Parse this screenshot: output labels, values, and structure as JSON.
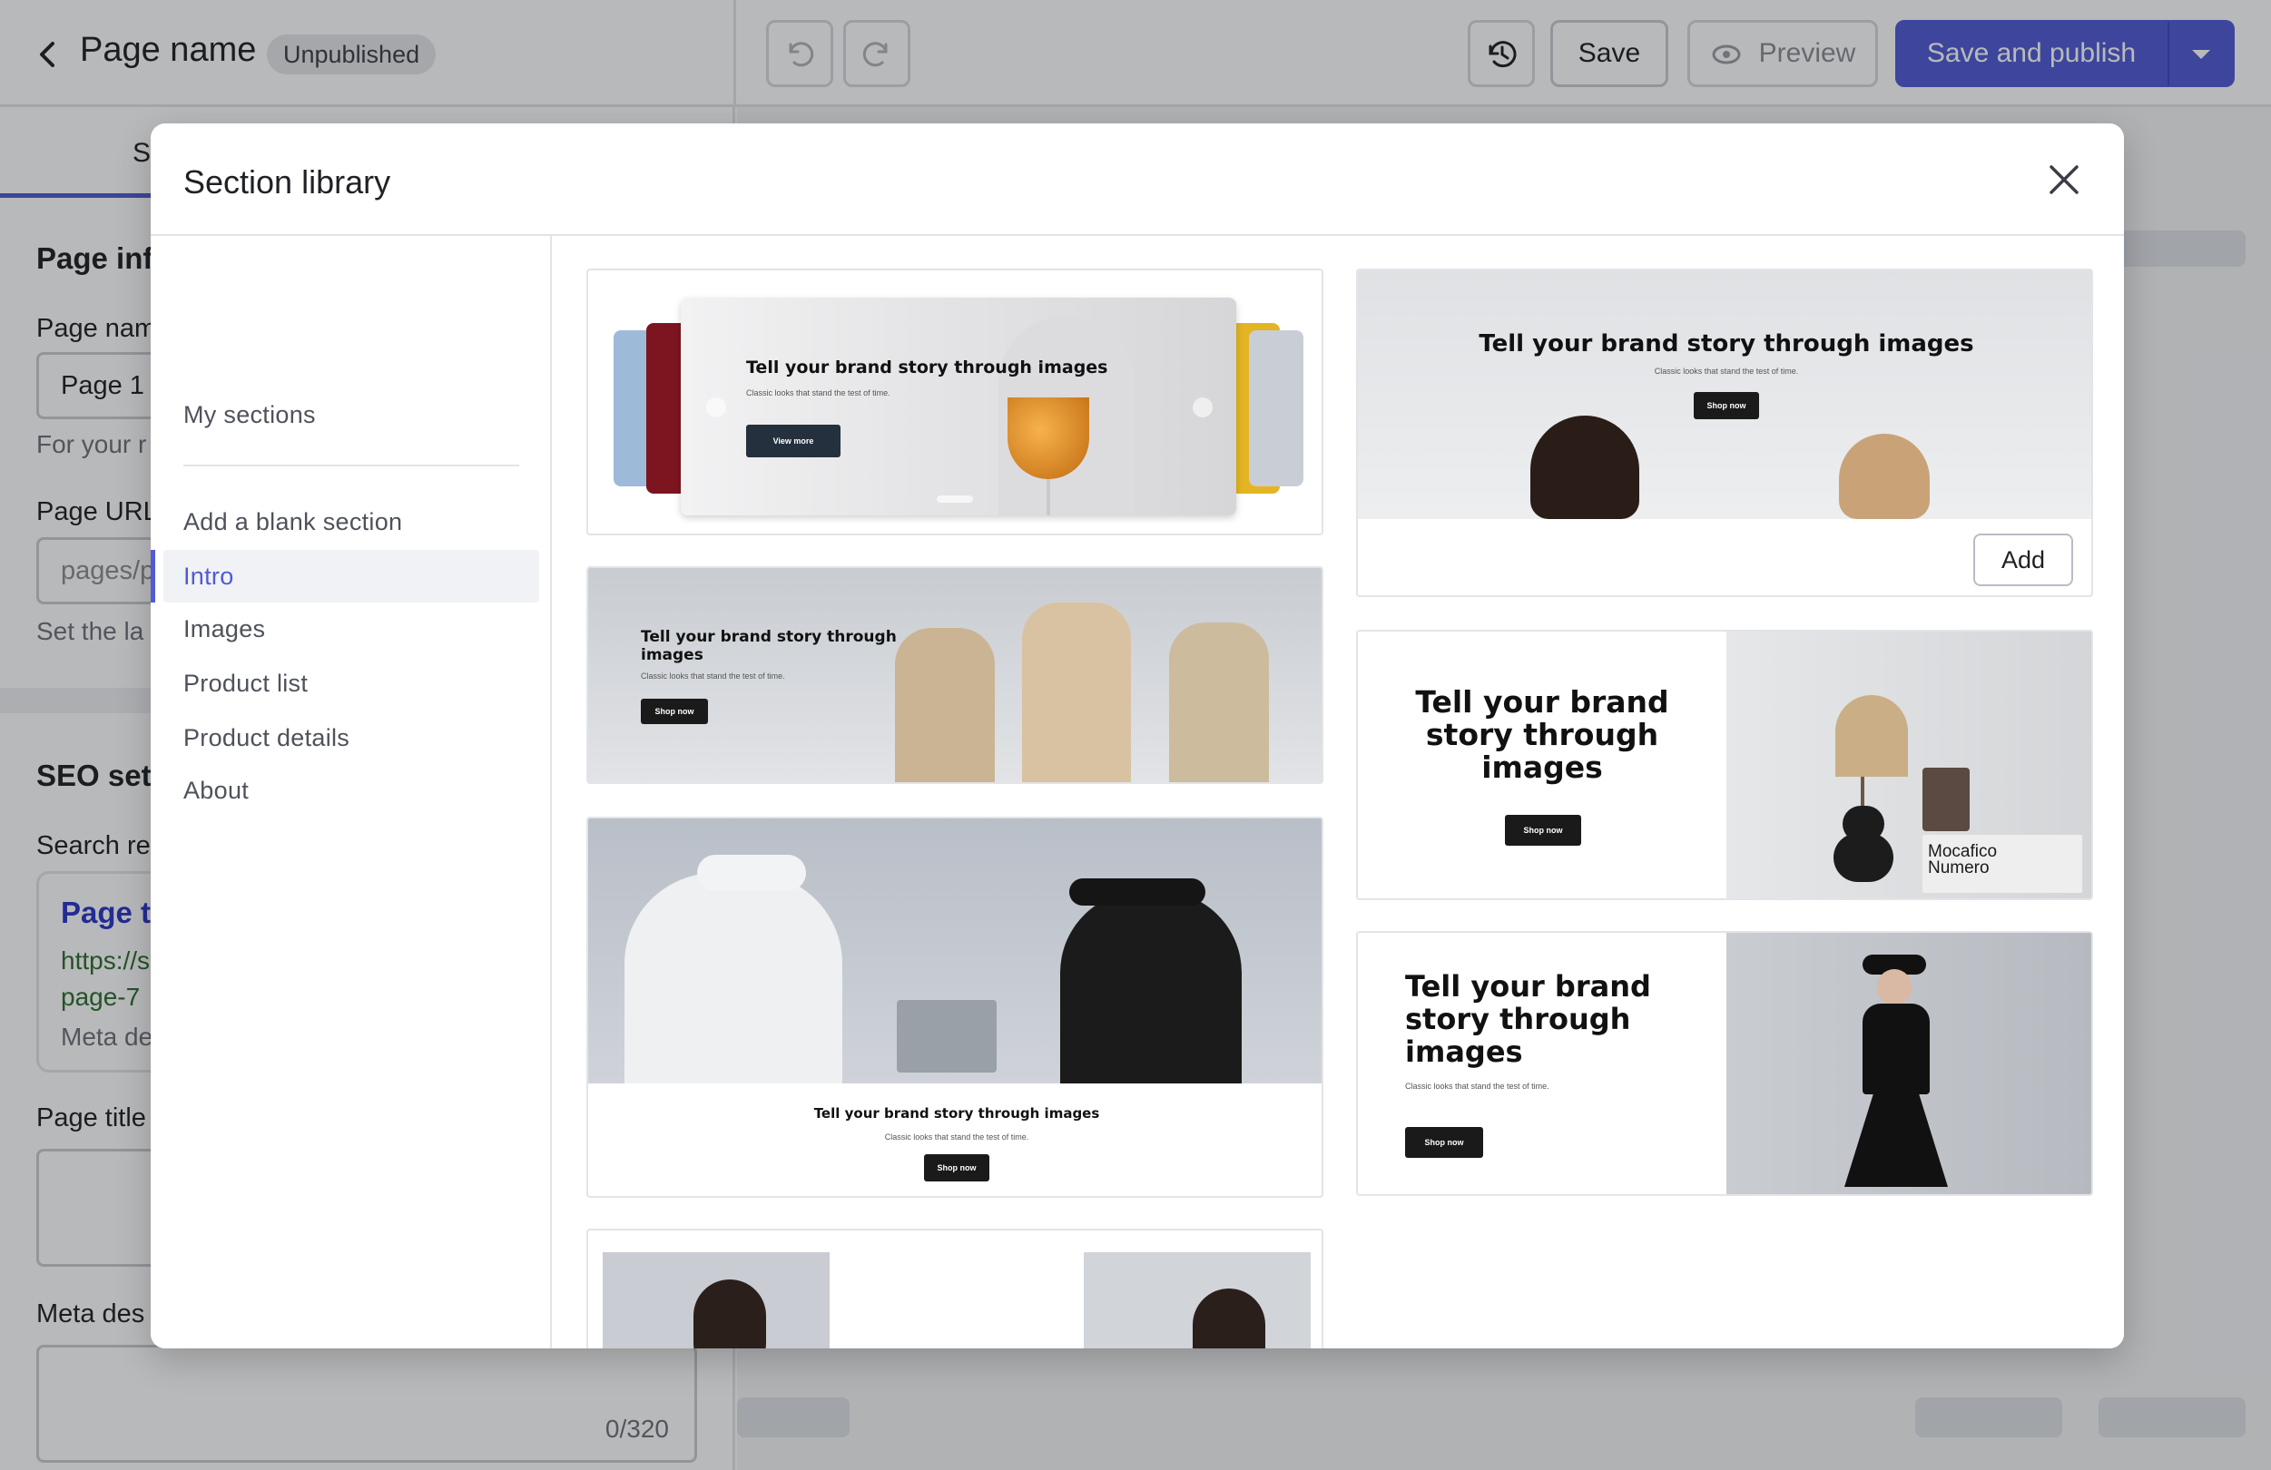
{
  "header": {
    "page_name": "Page name",
    "status_badge": "Unpublished",
    "save_label": "Save",
    "preview_label": "Preview",
    "publish_label": "Save and publish"
  },
  "left_panel": {
    "tab_label": "S",
    "page_info_heading": "Page inf",
    "page_name_label": "Page nam",
    "page_name_value": "Page 1",
    "page_name_help": "For your r",
    "page_url_label": "Page URL",
    "page_url_value": "pages/p",
    "page_url_help": "Set the la",
    "seo_heading": "SEO set",
    "search_label": "Search re",
    "seo_title": "Page t",
    "seo_url_1": "https://s",
    "seo_url_2": "page-7",
    "seo_meta": "Meta de",
    "page_title_label": "Page title",
    "meta_label": "Meta des",
    "meta_counter": "0/320"
  },
  "modal": {
    "title": "Section library",
    "nav": [
      "My sections",
      "Add a blank section",
      "Intro",
      "Images",
      "Product list",
      "Product details",
      "About"
    ],
    "active_nav": "Intro",
    "add_label": "Add"
  },
  "thumbs": {
    "headline": "Tell your brand story through images",
    "headline_l1": "Tell your brand",
    "headline_l2": "story through",
    "headline_l3": "images",
    "headline_2a": "Tell your brand story through",
    "headline_2b": "images",
    "sub": "Classic looks that stand the test of time.",
    "view_more": "View more",
    "shop_now": "Shop now",
    "book_l1": "Mocafico",
    "book_l2": "Numero"
  },
  "colors": {
    "accent": "#4f5bd5",
    "overlay": "rgba(20,22,28,0.3)"
  }
}
